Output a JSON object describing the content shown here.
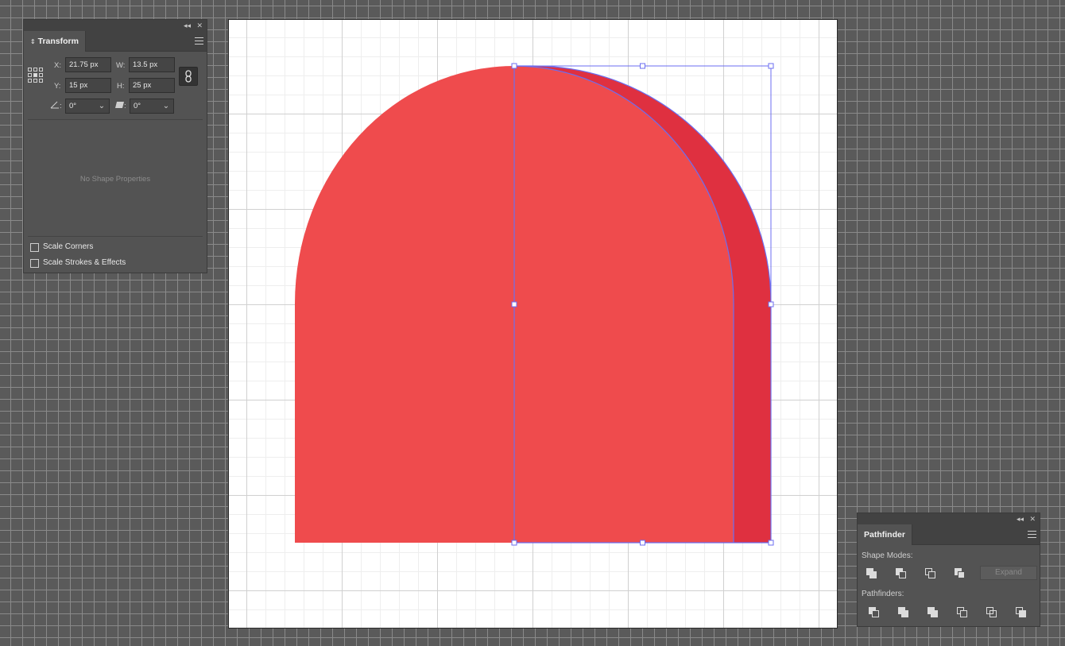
{
  "colors": {
    "shape_fill": "#ef4b4d",
    "shape_shadow": "#df3040",
    "selection": "#6b6ef0"
  },
  "transform": {
    "tab_label": "Transform",
    "x_label": "X:",
    "x_value": "21.75 px",
    "y_label": "Y:",
    "y_value": "15 px",
    "w_label": "W:",
    "w_value": "13.5 px",
    "h_label": "H:",
    "h_value": "25 px",
    "rotate_value": "0°",
    "shear_value": "0°",
    "no_shape_properties": "No Shape Properties",
    "scale_corners": "Scale Corners",
    "scale_strokes": "Scale Strokes & Effects"
  },
  "pathfinder": {
    "tab_label": "Pathfinder",
    "shape_modes_label": "Shape Modes:",
    "expand_label": "Expand",
    "pathfinders_label": "Pathfinders:"
  }
}
